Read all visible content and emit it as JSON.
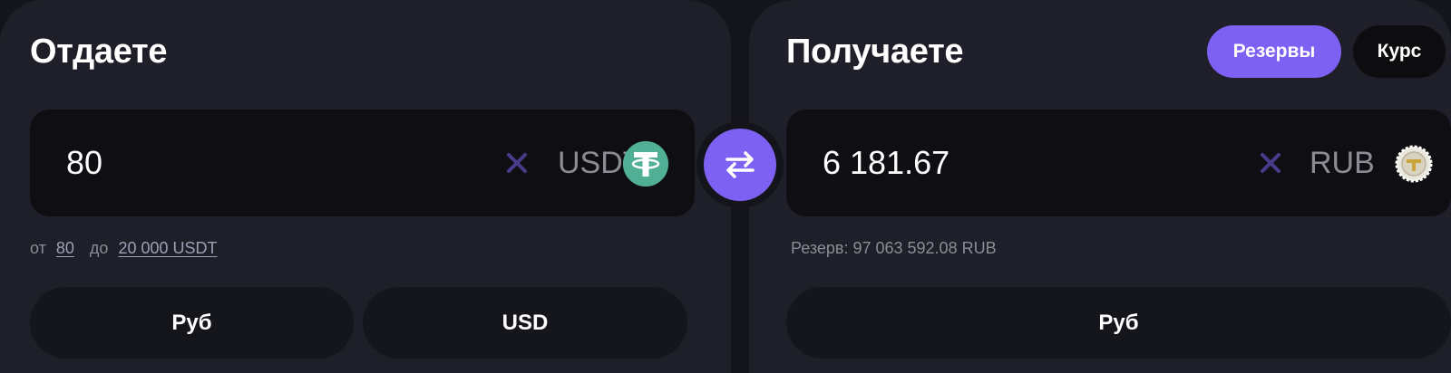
{
  "give": {
    "title": "Отдаете",
    "amount": "80",
    "currency": "USDT",
    "coin_icon": "tether-icon",
    "range": {
      "from_label": "от",
      "min": "80",
      "to_label": "до",
      "max": "20 000 USDT"
    },
    "buttons": [
      "Руб",
      "USD"
    ]
  },
  "get": {
    "title": "Получаете",
    "amount": "6 181.67",
    "currency": "RUB",
    "coin_icon": "tinkoff-bank-icon",
    "reserve": "Резерв: 97 063 592.08 RUB",
    "buttons": [
      "Руб"
    ]
  },
  "header_buttons": {
    "reserves": "Резервы",
    "rate": "Курс"
  },
  "colors": {
    "accent": "#7d61f2",
    "tether_green": "#50af95",
    "clear_x": "#4a3a8c",
    "panel_bg": "#1f1f29",
    "input_bg": "#0f0f13"
  }
}
